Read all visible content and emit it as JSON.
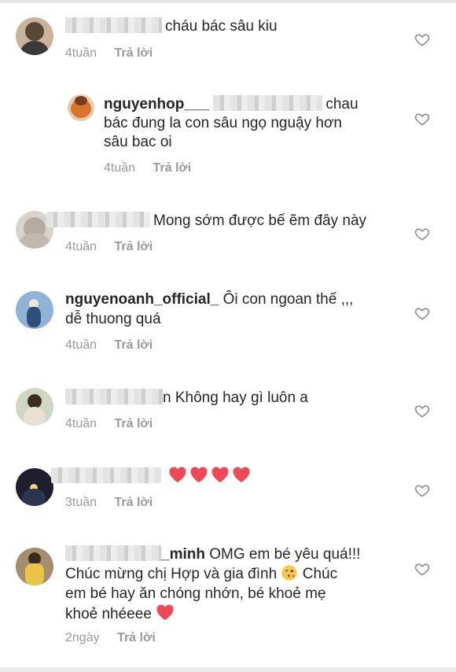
{
  "comments": [
    {
      "username": "",
      "text": "cháu bác sâu kiu",
      "time": "4tuần",
      "reply_label": "Trả lời"
    },
    {
      "username": "nguyenhop___",
      "text": "@ chau bác đung la con sâu ngọ nguậy hơn sâu bac oi",
      "text_line1": "chau",
      "text_line2": "bác đung la con sâu ngọ nguậy hơn",
      "text_line3": "sâu bac oi",
      "time": "4tuần",
      "reply_label": "Trả lời"
    },
    {
      "username": "",
      "text": "Mong sớm được bế ẽm đây này",
      "time": "4tuần",
      "reply_label": "Trả lời"
    },
    {
      "username": "nguyenoanh_official_",
      "text_line1": "Ôi con ngoan thế ,,,",
      "text_line2": "dễ thuong quá",
      "time": "4tuần",
      "reply_label": "Trả lời"
    },
    {
      "username": "",
      "text": "n Không hay gì luôn a",
      "time": "4tuần",
      "reply_label": "Trả lời"
    },
    {
      "username": "",
      "text": "❤❤❤❤",
      "time": "3tuần",
      "reply_label": "Trả lời"
    },
    {
      "username": "_minh",
      "text_line1": "OMG em bé yêu quá!!!",
      "text_line2a": "Chúc mừng chị Hợp và gia đình",
      "text_line2b": "Chúc",
      "text_line3": "em bé hay ăn chóng nhớn, bé khoẻ mẹ",
      "text_line4": "khoẻ nhéeee",
      "time": "2ngày",
      "reply_label": "Trả lời"
    }
  ],
  "colors": {
    "text": "#262626",
    "meta": "#9a9a9a",
    "heart_emoji": "#ed4956",
    "heart_outline": "#8e8e8e"
  },
  "icons": {
    "like": "heart-outline-icon",
    "emoji": "red-heart-emoji",
    "kiss": "face-blowing-kiss-emoji"
  }
}
